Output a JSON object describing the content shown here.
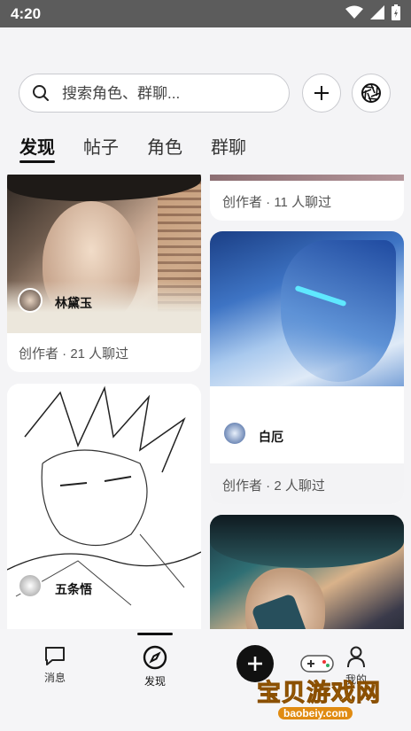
{
  "status_bar": {
    "time": "4:20"
  },
  "search": {
    "placeholder": "搜索角色、群聊..."
  },
  "tabs": [
    {
      "label": "发现",
      "active": true
    },
    {
      "label": "帖子",
      "active": false
    },
    {
      "label": "角色",
      "active": false
    },
    {
      "label": "群聊",
      "active": false
    }
  ],
  "cards": {
    "top_right_meta": "创作者 · 11 人聊过",
    "lindaiyu": {
      "name": "林黛玉",
      "meta": "创作者 · 21 人聊过"
    },
    "baie": {
      "name": "白厄",
      "meta": "创作者 · 2 人聊过"
    },
    "wutiaowu": {
      "name": "五条悟"
    }
  },
  "bottom_nav": {
    "messages": "消息",
    "discover": "发现",
    "profile_partial": "我的"
  },
  "watermark": {
    "title": "宝贝游戏网",
    "url": "baobeiy.com"
  },
  "colors": {
    "accent": "#111111",
    "watermark": "#f3a51b"
  }
}
